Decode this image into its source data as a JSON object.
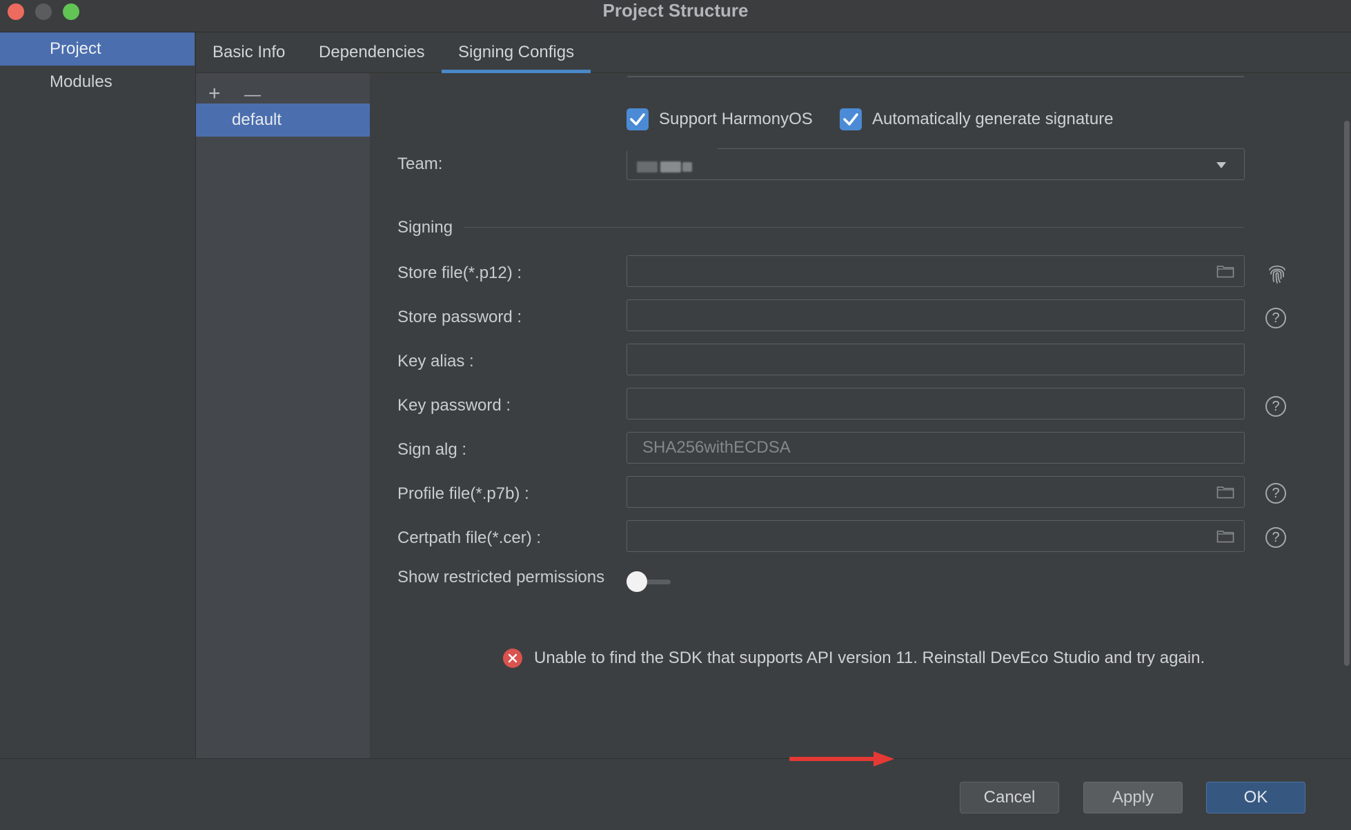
{
  "window": {
    "title": "Project Structure"
  },
  "left_nav": {
    "items": [
      {
        "label": "Project",
        "selected": true
      },
      {
        "label": "Modules",
        "selected": false
      }
    ]
  },
  "tabs": [
    {
      "label": "Basic Info",
      "active": false
    },
    {
      "label": "Dependencies",
      "active": false
    },
    {
      "label": "Signing Configs",
      "active": true
    }
  ],
  "config_list": {
    "add_symbol": "+",
    "remove_symbol": "—",
    "items": [
      {
        "label": "default",
        "selected": true
      }
    ]
  },
  "form": {
    "support_harmonyos": {
      "label": "Support HarmonyOS",
      "checked": true
    },
    "auto_signature": {
      "label": "Automatically generate signature",
      "checked": true
    },
    "team": {
      "label": "Team:",
      "value": ""
    },
    "signing_section": "Signing",
    "store_file": {
      "label": "Store file(*.p12) :",
      "value": ""
    },
    "store_password": {
      "label": "Store password :",
      "value": ""
    },
    "key_alias": {
      "label": "Key alias :",
      "value": ""
    },
    "key_password": {
      "label": "Key password :",
      "value": ""
    },
    "sign_alg": {
      "label": "Sign alg :",
      "value": "SHA256withECDSA"
    },
    "profile_file": {
      "label": "Profile file(*.p7b) :",
      "value": ""
    },
    "certpath_file": {
      "label": "Certpath file(*.cer) :",
      "value": ""
    },
    "restricted_permissions": {
      "label": "Show restricted permissions",
      "enabled": false
    },
    "help_symbol": "?"
  },
  "error": {
    "message": "Unable to find the SDK that supports API version 11. Reinstall DevEco Studio and try again.",
    "icon_symbol": "✕"
  },
  "buttons": {
    "cancel": "Cancel",
    "apply": "Apply",
    "ok": "OK"
  },
  "colors": {
    "accent": "#4b6eaf",
    "checkbox": "#4b8bd6",
    "error": "#d9534f",
    "annotation_arrow": "#e53935"
  },
  "icons": {
    "folder": "folder-icon",
    "fingerprint": "fingerprint-icon",
    "help": "help-icon",
    "error": "error-icon"
  }
}
